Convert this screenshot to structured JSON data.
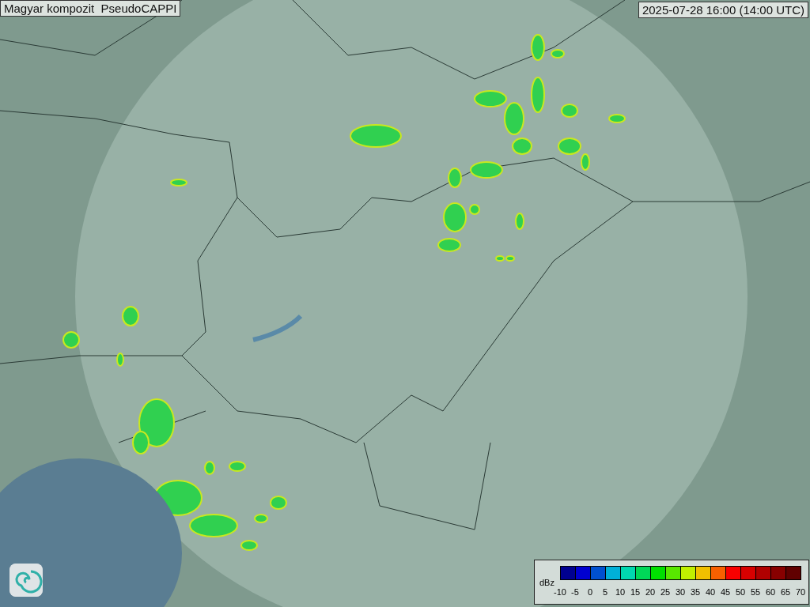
{
  "title": "Magyar kompozit  PseudoCAPPI",
  "timestamp": "2025-07-28 16:00 (14:00 UTC)",
  "legend": {
    "unit": "dBz",
    "bins": [
      {
        "color": "#000090"
      },
      {
        "color": "#0000d0"
      },
      {
        "color": "#0050d0"
      },
      {
        "color": "#00b0d8"
      },
      {
        "color": "#00d8b0"
      },
      {
        "color": "#00d858"
      },
      {
        "color": "#00e000"
      },
      {
        "color": "#58e800"
      },
      {
        "color": "#c0f000"
      },
      {
        "color": "#f0c000"
      },
      {
        "color": "#f86000"
      },
      {
        "color": "#f80000"
      },
      {
        "color": "#d80000"
      },
      {
        "color": "#b00000"
      },
      {
        "color": "#880000"
      },
      {
        "color": "#600000"
      }
    ],
    "ticks": [
      "-10",
      "-5",
      "0",
      "5",
      "10",
      "15",
      "20",
      "25",
      "30",
      "35",
      "40",
      "45",
      "50",
      "55",
      "60",
      "65",
      "70"
    ]
  }
}
